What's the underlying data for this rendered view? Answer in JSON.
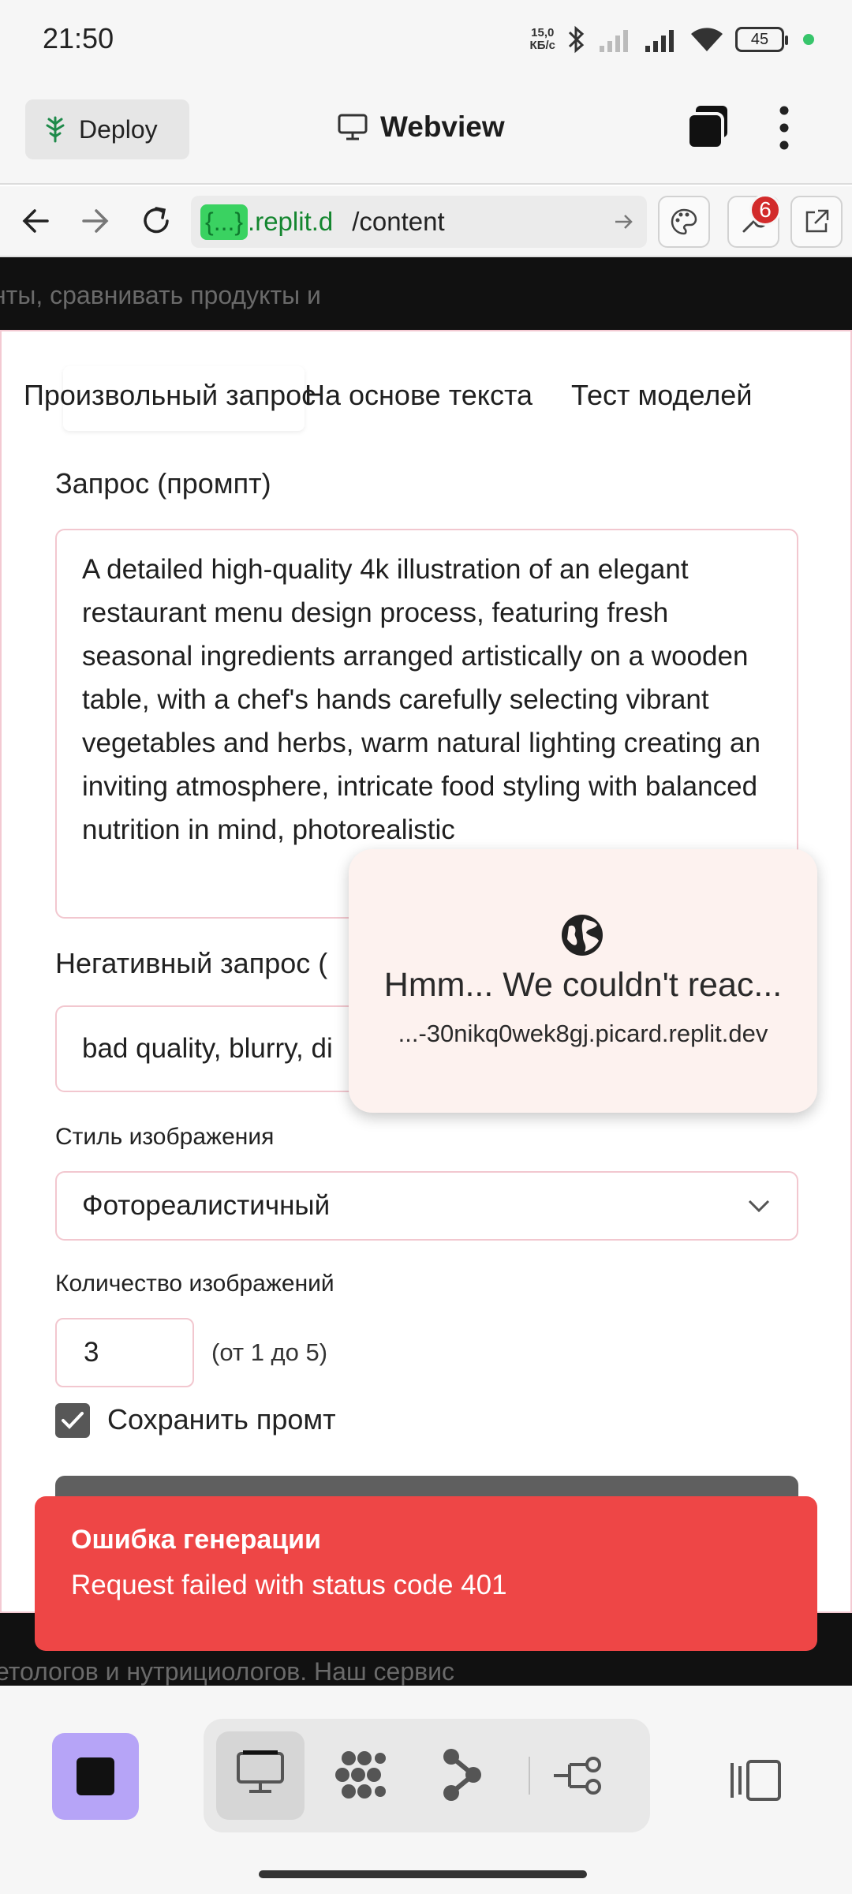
{
  "status_bar": {
    "time": "21:50",
    "net_speed_value": "15,0",
    "net_speed_unit": "КБ/с",
    "battery": "45"
  },
  "app_bar": {
    "deploy_label": "Deploy",
    "title": "Webview"
  },
  "url_bar": {
    "chip": "{...}",
    "host": ".replit.d",
    "path": "/content",
    "badge_count": "6"
  },
  "background": {
    "top_text": "нты, сравнивать продукты и",
    "bottom_text": "етологов и нутрициологов. Наш сервис"
  },
  "tabs": [
    {
      "label": "Произвольный запрос"
    },
    {
      "label": "На основе текста"
    },
    {
      "label": "Тест моделей"
    }
  ],
  "form": {
    "prompt_label": "Запрос (промпт)",
    "prompt_value": "A detailed high-quality 4k illustration of an elegant restaurant menu design process, featuring fresh seasonal ingredients arranged artistically on a wooden table, with a chef's hands carefully selecting vibrant vegetables and herbs, warm natural lighting creating an inviting atmosphere, intricate food styling with balanced nutrition in mind, photorealistic",
    "negative_label": "Негативный запрос (",
    "negative_value": "bad quality, blurry, di",
    "style_label": "Стиль изображения",
    "style_value": "Фотореалистичный",
    "count_label": "Количество изображений",
    "count_value": "3",
    "count_hint": "(от 1 до 5)",
    "save_prompt_label": "Сохранить промт",
    "save_prompt_checked": true
  },
  "toast": {
    "title": "Ошибка генерации",
    "message": "Request failed with status code 401"
  },
  "network_popup": {
    "title": "Hmm... We couldn't reac...",
    "host": "...-30nikq0wek8gj.picard.replit.dev"
  },
  "colors": {
    "toast_bg": "#ee4646",
    "stop_button": "#b6a4f7",
    "url_chip": "#3ad261",
    "field_border": "#f2c7cf"
  },
  "icons": {
    "deploy": "deploy-tree-icon",
    "webview": "monitor-icon",
    "tabs": "tabs-icon",
    "menu": "kebab-menu-icon",
    "back": "arrow-left-icon",
    "forward": "arrow-right-icon",
    "reload": "reload-icon",
    "theme": "palette-icon",
    "devtools": "wrench-icon",
    "external": "external-link-icon",
    "globe": "globe-icon",
    "chevron": "chevron-down-icon"
  }
}
